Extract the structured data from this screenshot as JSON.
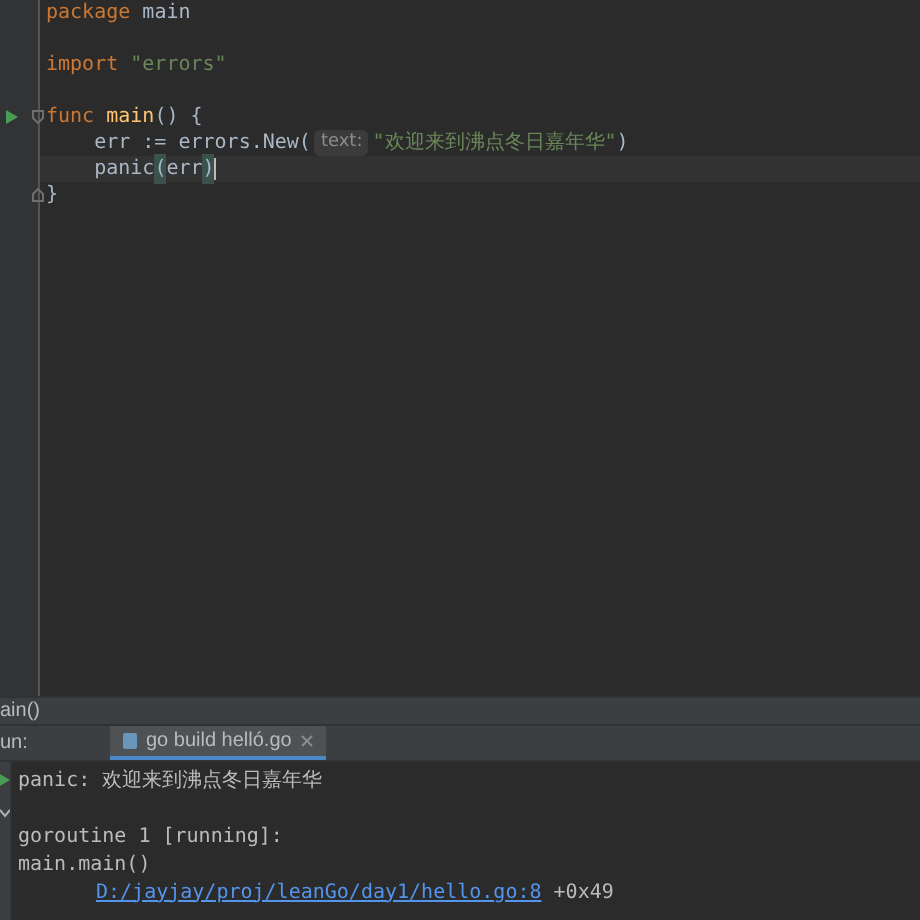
{
  "editor": {
    "lines": [
      {
        "runnable": false,
        "fold_start": false,
        "fold_end": false,
        "current": false,
        "tokens": [
          {
            "kind": "keyword",
            "text": "package"
          },
          {
            "kind": "plain",
            "text": " main"
          }
        ]
      },
      {
        "runnable": false,
        "fold_start": false,
        "fold_end": false,
        "current": false
      },
      {
        "runnable": false,
        "fold_start": false,
        "fold_end": false,
        "current": false,
        "tokens": [
          {
            "kind": "keyword",
            "text": "import"
          },
          {
            "kind": "string",
            "text": " \"errors\""
          }
        ]
      },
      {
        "runnable": false,
        "fold_start": false,
        "fold_end": false,
        "current": false
      },
      {
        "runnable": true,
        "fold_start": true,
        "fold_end": false,
        "current": false,
        "tokens": [
          {
            "kind": "keyword",
            "text": "func"
          },
          {
            "kind": "function",
            "text": " main"
          },
          {
            "kind": "plain",
            "text": "() {"
          }
        ]
      },
      {
        "runnable": false,
        "fold_start": false,
        "fold_end": false,
        "current": false,
        "tokens": [
          {
            "kind": "plain",
            "text": "    err := errors.New("
          },
          {
            "kind": "hint",
            "text": "text:"
          },
          {
            "kind": "string",
            "text": "\"欢迎来到沸点冬日嘉年华\""
          },
          {
            "kind": "plain",
            "text": ")"
          }
        ]
      },
      {
        "runnable": false,
        "fold_start": false,
        "fold_end": false,
        "current": true,
        "tokens": [
          {
            "kind": "plain",
            "text": "    panic"
          },
          {
            "kind": "brace_match",
            "text": "("
          },
          {
            "kind": "plain",
            "text": "err"
          },
          {
            "kind": "brace_match",
            "text": ")"
          }
        ]
      },
      {
        "runnable": false,
        "fold_start": false,
        "fold_end": true,
        "current": false,
        "tokens": [
          {
            "kind": "plain",
            "text": "}"
          }
        ]
      }
    ]
  },
  "breadcrumb": "ain()",
  "run_panel": {
    "label": "un:",
    "tabs": [
      {
        "label": "go build helló.go",
        "selected": true
      }
    ],
    "console": [
      {
        "indented": false,
        "parts": [
          {
            "kind": "plain",
            "text": "panic: 欢迎来到沸点冬日嘉年华"
          }
        ]
      },
      {
        "blank": true
      },
      {
        "indented": false,
        "parts": [
          {
            "kind": "plain",
            "text": "goroutine 1 [running]:"
          }
        ]
      },
      {
        "indented": false,
        "parts": [
          {
            "kind": "plain",
            "text": "main.main()"
          }
        ]
      },
      {
        "indented": true,
        "parts": [
          {
            "kind": "link",
            "text": "D:/jayjay/proj/leanGo/day1/hello.go:8"
          },
          {
            "kind": "plain",
            "text": " +0x49"
          }
        ]
      }
    ]
  }
}
